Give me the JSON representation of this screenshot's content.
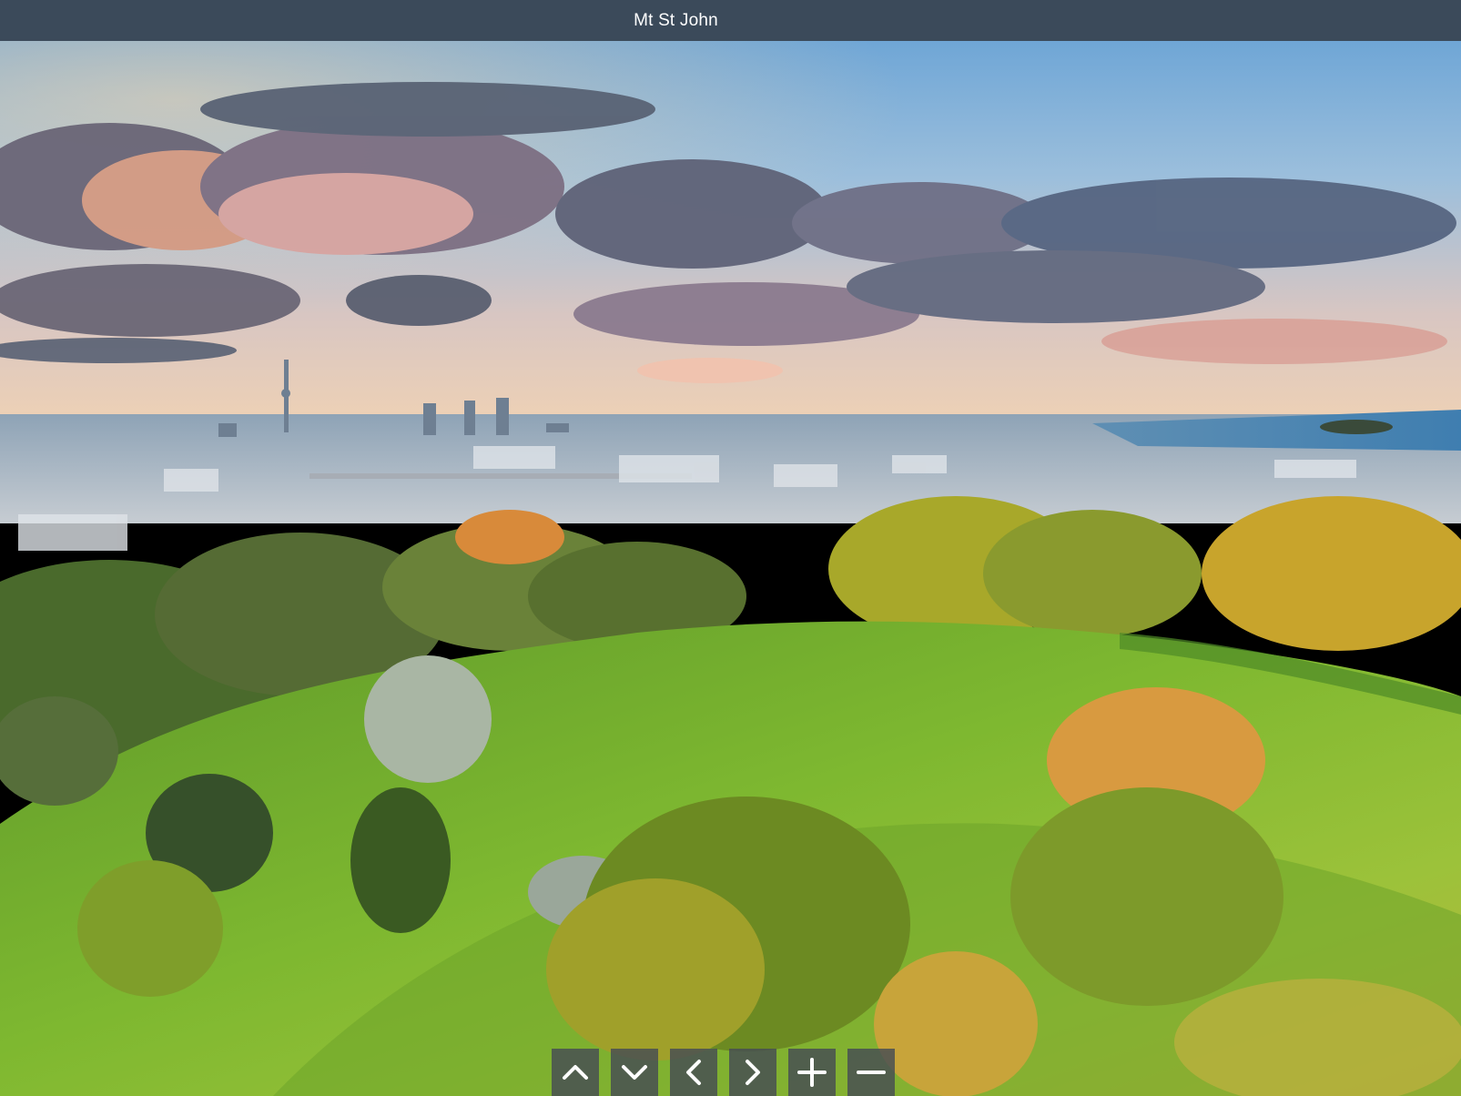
{
  "viewer": {
    "title": "Mt St John"
  },
  "controls": [
    {
      "name": "pan-up-button",
      "icon": "chevron-up-icon",
      "action": "up"
    },
    {
      "name": "pan-down-button",
      "icon": "chevron-down-icon",
      "action": "down"
    },
    {
      "name": "pan-left-button",
      "icon": "chevron-left-icon",
      "action": "left"
    },
    {
      "name": "pan-right-button",
      "icon": "chevron-right-icon",
      "action": "right"
    },
    {
      "name": "zoom-in-button",
      "icon": "plus-icon",
      "action": "zoom-in"
    },
    {
      "name": "zoom-out-button",
      "icon": "minus-icon",
      "action": "zoom-out"
    }
  ],
  "colors": {
    "title_bar": "#3b4a5a",
    "button_bg": "#464c54",
    "icon": "#ffffff"
  }
}
